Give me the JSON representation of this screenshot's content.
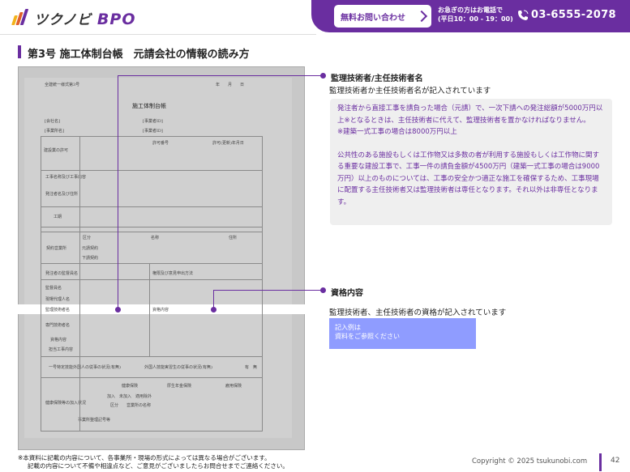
{
  "header": {
    "logo_text": "ツクノビ",
    "logo_suffix": "BPO",
    "cta_button": "無料お問い合わせ",
    "cta_note_line1": "お急ぎの方はお電話で",
    "cta_note_line2": "(平日10：00 - 19：00)",
    "phone": "03-6555-2078",
    "brand_color": "#6a2ea0"
  },
  "page": {
    "title": "第3号 施工体制台帳　元請会社の情報の読み方"
  },
  "form": {
    "corner_label": "全建統一様式第3号",
    "date_label": "年　　月　　日",
    "doc_title": "施工体制台帳",
    "rows": [
      "[会社名]",
      "[事業所名]",
      "建設業の許可",
      "工事名称及び工事内容",
      "発注者名及び住所",
      "工期",
      "契約営業所",
      "発注者の監督員名",
      "監督員名",
      "現場代理人名",
      "監理技術者名",
      "専門技術者名",
      "資格内容",
      "担当工事内容",
      "一号特定技能外国人の従事の状況(有無)",
      "健康保険等の加入状況"
    ],
    "table_headers": [
      "区分",
      "名称",
      "住所"
    ],
    "sub_rows": [
      "元請契約",
      "下請契約"
    ],
    "right_labels": [
      "[事業者ID]",
      "[事業者ID]",
      "許可番号",
      "許可(更新)年月日",
      "権限及び意見申出方法",
      "資格内容",
      "外国人技能実習生の従事の状況(有無)"
    ],
    "insurance_headers": [
      "健康保険",
      "厚生年金保険",
      "雇用保険"
    ],
    "misc": [
      "有　無",
      "加入　未加入　適用除外",
      "事業所整理記号等",
      "区分",
      "営業所の名称"
    ]
  },
  "sections": [
    {
      "title": "監理技術者/主任技術者名",
      "desc": "監理技術者か主任技術者名が記入されています",
      "details": [
        "発注者から直接工事を請負った場合（元請）で、一次下請への発注総額が5000万円以上※となるときは、主任技術者に代えて、監理技術者を置かなければなりません。",
        "※建築一式工事の場合は8000万円以上",
        "公共性のある施設もしくは工作物又は多数の者が利用する施設もしくは工作物に関する重要な建設工事で、工事一件の請負金額が4500万円（建築一式工事の場合は9000万円）以上のものについては、工事の安全かつ適正な施工を確保するため、工事現場に配置する主任技術者又は監理技術者は専任となります。それ以外は非専任となります。"
      ]
    },
    {
      "title": "資格内容",
      "desc": "監理技術者、主任技術者の資格が記入されています",
      "example_line1": "記入例は",
      "example_line2": "資料をご参照ください"
    }
  ],
  "footer": {
    "note_line1": "※本資料に記載の内容について、各事業所・現場の形式によっては異なる場合がございます。",
    "note_line2": "記載の内容について不備や相違点など、ご意見がございましたらお問合せまでご連絡ください。",
    "copyright": "Copyright © 2025 tsukunobi.com",
    "page_number": "42"
  }
}
